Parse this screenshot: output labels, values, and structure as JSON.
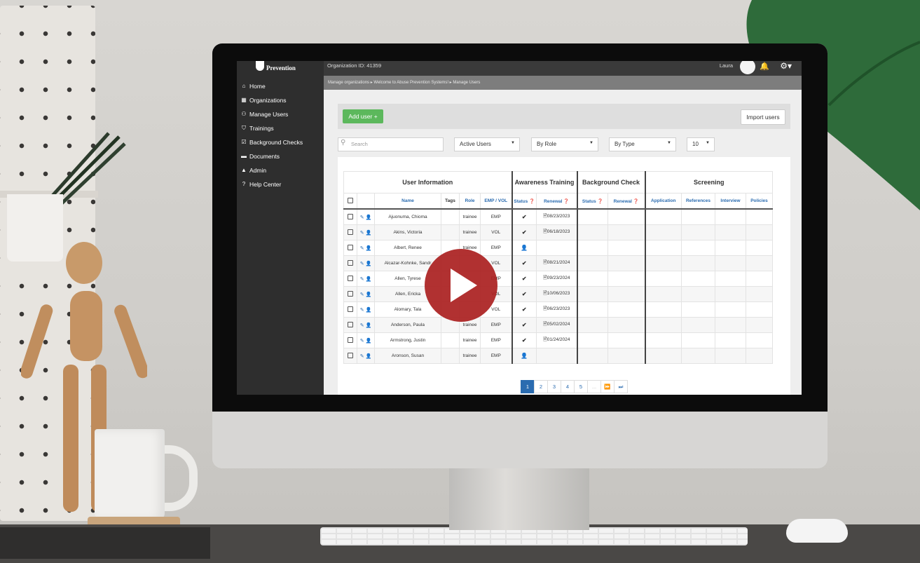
{
  "app": {
    "logo_text": "Prevention",
    "org_id": "Organization ID: 41359",
    "user_name": "Laura"
  },
  "sidebar": {
    "items": [
      {
        "label": "Home",
        "icon": "home-icon",
        "glyph": "⌂"
      },
      {
        "label": "Organizations",
        "icon": "building-icon",
        "glyph": "▦"
      },
      {
        "label": "Manage Users",
        "icon": "users-icon",
        "glyph": "⚇"
      },
      {
        "label": "Trainings",
        "icon": "shield-icon",
        "glyph": "⛉"
      },
      {
        "label": "Background Checks",
        "icon": "checkbox-icon",
        "glyph": "☑"
      },
      {
        "label": "Documents",
        "icon": "folder-icon",
        "glyph": "▬"
      },
      {
        "label": "Admin",
        "icon": "lock-icon",
        "glyph": "▲"
      },
      {
        "label": "Help Center",
        "icon": "question-icon",
        "glyph": "?"
      }
    ]
  },
  "breadcrumb": "Manage organizations  ▸  Welcome to Abuse Prevention Systems!  ▸  Manage Users",
  "toolbar": {
    "add_label": "Add user +",
    "import_label": "Import users"
  },
  "filters": {
    "search_placeholder": "Search",
    "status": "Active Users",
    "role": "By Role",
    "type": "By Type",
    "per_page": "10"
  },
  "table": {
    "groups": [
      "User Information",
      "Awareness Training",
      "Background Check",
      "Screening"
    ],
    "columns": [
      "Name",
      "Tags",
      "Role",
      "EMP / VOL",
      "Status ❓",
      "Renewal ❓",
      "Status ❓",
      "Renewal ❓",
      "Application",
      "References",
      "Interview",
      "Policies"
    ],
    "rows": [
      {
        "name": "Ajuonuma, Chioma",
        "role": "trainee",
        "type": "EMP",
        "status": "✔",
        "renewal": "08/23/2023"
      },
      {
        "name": "Akins, Victoria",
        "role": "trainee",
        "type": "VOL",
        "status": "✔",
        "renewal": "06/18/2023"
      },
      {
        "name": "Albert, Renee",
        "role": "trainee",
        "type": "EMP",
        "status": "👤",
        "renewal": ""
      },
      {
        "name": "Alcazar-Kohnke, Sandr",
        "role": "",
        "type": "VOL",
        "status": "✔",
        "renewal": "08/21/2024"
      },
      {
        "name": "Allen, Tyrese",
        "role": "",
        "type": "EMP",
        "status": "✔",
        "renewal": "09/23/2024"
      },
      {
        "name": "Allen, Ericka",
        "role": "",
        "type": "VOL",
        "status": "✔",
        "renewal": "10/06/2023"
      },
      {
        "name": "Alomary, Tala",
        "role": "",
        "type": "VOL",
        "status": "✔",
        "renewal": "06/23/2023"
      },
      {
        "name": "Anderson, Paula",
        "role": "trainee",
        "type": "EMP",
        "status": "✔",
        "renewal": "05/02/2024"
      },
      {
        "name": "Armstrong, Justin",
        "role": "trainee",
        "type": "EMP",
        "status": "✔",
        "renewal": "01/24/2024"
      },
      {
        "name": "Aronson, Susan",
        "role": "trainee",
        "type": "EMP",
        "status": "👤",
        "renewal": ""
      }
    ]
  },
  "pager": {
    "pages": [
      "1",
      "2",
      "3",
      "4",
      "5",
      "..."
    ],
    "active": "1",
    "next": "⏩",
    "last": "⏭"
  },
  "colors": {
    "sidebar": "#2e2e2e",
    "accent": "#2b6cb0",
    "add_button": "#5cb85c",
    "play_button": "#aa2020"
  }
}
